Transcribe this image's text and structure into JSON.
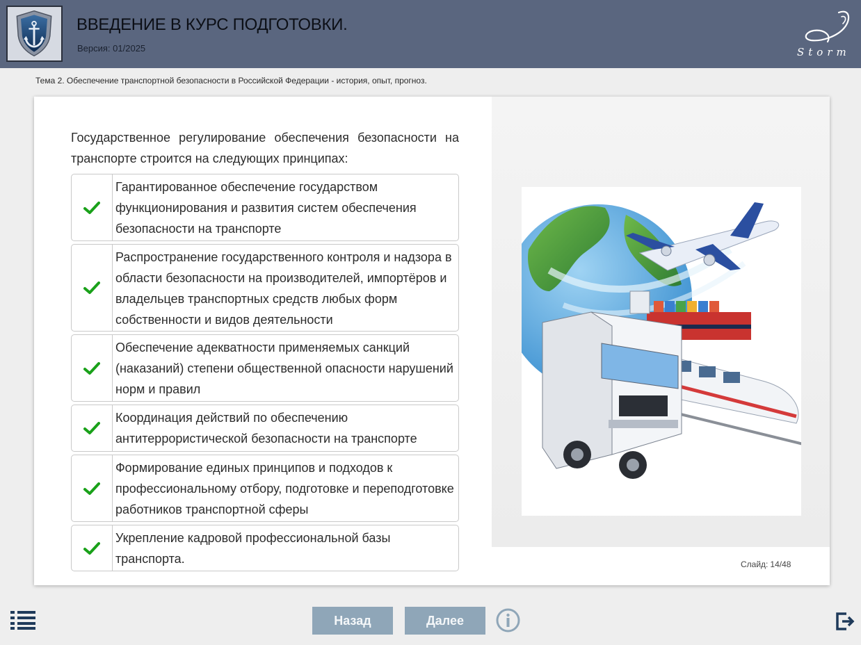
{
  "header": {
    "title": "ВВЕДЕНИЕ В КУРС ПОДГОТОВКИ.",
    "version": "Версия: 01/2025",
    "logo_icon": "anchor-shield-icon",
    "brand_text": "Storm",
    "background": "#5a667f"
  },
  "topic": "Тема 2. Обеспечение транспортной безопасности в Российской Федерации - история, опыт, прогноз.",
  "slide": {
    "intro": "Государственное регулирование обеспечения безопасности на транспорте строится на следующих принципах:",
    "items": [
      {
        "icon": "check-icon",
        "text": "Гарантированное обеспечение государством функционирования и развития систем обеспечения безопасности на транспорте"
      },
      {
        "icon": "check-icon",
        "text": "Распространение государственного контроля и надзора в области безопасности на производителей, импортёров и владельцев транспортных средств любых форм собственности и видов деятельности"
      },
      {
        "icon": "check-icon",
        "text": "Обеспечение адекватности применяемых санкций (наказаний) степени общественной опасности нарушений норм и правил"
      },
      {
        "icon": "check-icon",
        "text": "Координация действий по обеспечению антитеррористической безопасности на транспорте"
      },
      {
        "icon": "check-icon",
        "text": "Формирование единых принципов и подходов к профессиональному отбору, подготовке и переподготовке работников транспортной сферы"
      },
      {
        "icon": "check-icon",
        "text": "Укрепление кадровой профессиональной базы транспорта."
      }
    ],
    "image": "transport-globe-illustration",
    "counter_label": "Слайд:",
    "counter_value": "14/48"
  },
  "footer": {
    "menu_icon": "menu-list-icon",
    "back_label": "Назад",
    "next_label": "Далее",
    "info_icon": "info-icon",
    "exit_icon": "exit-icon",
    "button_color": "#8fa6b8"
  },
  "colors": {
    "check": "#1aa11a",
    "accent_dark": "#1c3f66"
  }
}
